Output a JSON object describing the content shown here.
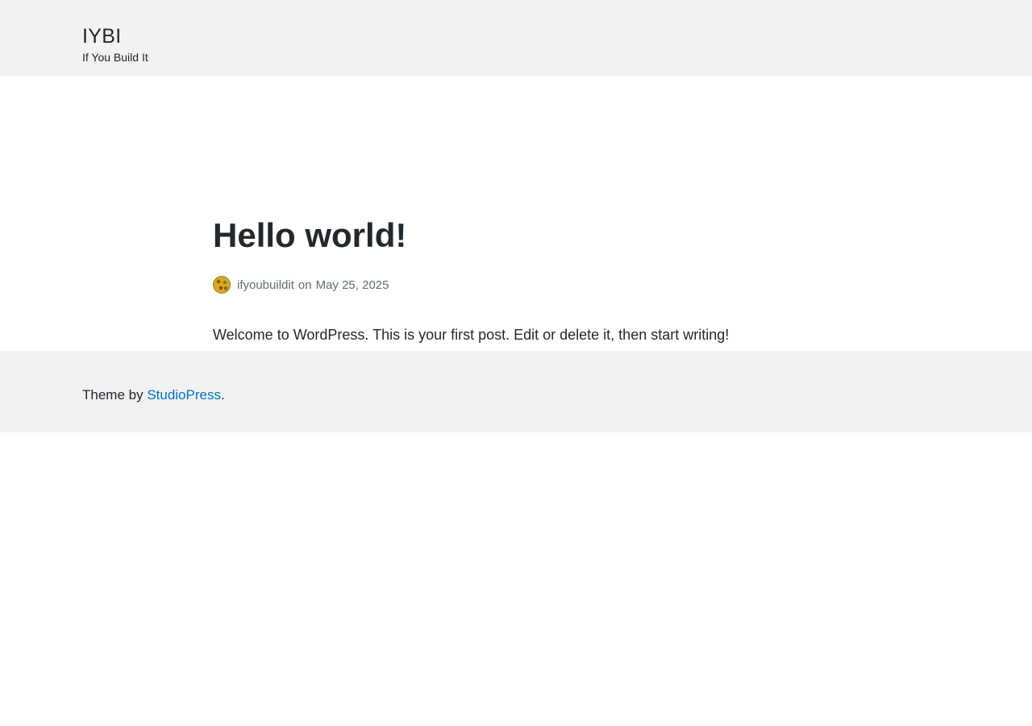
{
  "header": {
    "site_title": "IYBI",
    "tagline": "If You Build It"
  },
  "post": {
    "title": "Hello world!",
    "author": "ifyoubuildit",
    "on_text": "on",
    "date": "May 25, 2025",
    "body": "Welcome to WordPress. This is your first post. Edit or delete it, then start writing!"
  },
  "footer": {
    "prefix": "Theme by",
    "link_label": "StudioPress",
    "suffix": "."
  },
  "colors": {
    "header_bg": "#f2f2f2",
    "text": "#23282d",
    "meta_text": "#5e6d78",
    "link": "#0073c7"
  }
}
